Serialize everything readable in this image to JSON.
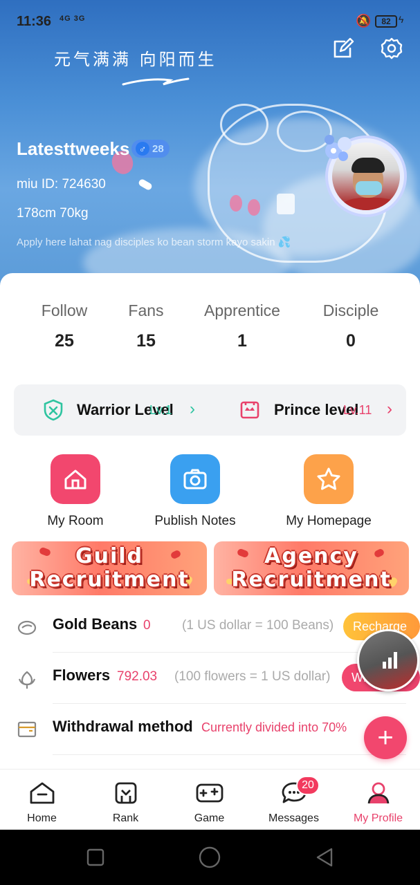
{
  "status_bar": {
    "time": "11:36",
    "network": "4G 3G",
    "battery": "82"
  },
  "header": {
    "slogan": "元气满满  向阳而生",
    "username": "Latesttweeks",
    "gender_symbol": "♂",
    "age": "28",
    "miu_id": "miu ID: 724630",
    "height_weight": "178cm 70kg",
    "bio": "Apply here lahat nag disciples ko bean storm kayo sakin 💦"
  },
  "counts": [
    {
      "label": "Follow",
      "value": "25"
    },
    {
      "label": "Fans",
      "value": "15"
    },
    {
      "label": "Apprentice",
      "value": "1"
    },
    {
      "label": "Disciple",
      "value": "0"
    }
  ],
  "levels": {
    "warrior": {
      "title": "Warrior Level",
      "value": "Lv.1",
      "color": "#2ec4a0"
    },
    "prince": {
      "title": "Prince level",
      "value": "Lv.11",
      "color": "#e8416b"
    }
  },
  "shortcuts": [
    {
      "label": "My Room",
      "color": "#f2476e"
    },
    {
      "label": "Publish Notes",
      "color": "#3aa0f0"
    },
    {
      "label": "My Homepage",
      "color": "#fda24a"
    }
  ],
  "banners": {
    "guild": {
      "line1": "Guild",
      "line2": "Recruitment"
    },
    "agency": {
      "line1": "Agency",
      "line2": "Recruitment"
    }
  },
  "rows": {
    "gold_beans": {
      "title": "Gold Beans",
      "value": "0",
      "note": "(1 US dollar = 100 Beans)",
      "button": "Recharge"
    },
    "flowers": {
      "title": "Flowers",
      "value": "792.03",
      "note": "(100 flowers = 1 US dollar)",
      "button": "Withdraw"
    },
    "withdrawal": {
      "title": "Withdrawal method",
      "value": "Currently divided into 70%"
    }
  },
  "fab": {
    "label": "+"
  },
  "tabs": [
    {
      "label": "Home"
    },
    {
      "label": "Rank"
    },
    {
      "label": "Game"
    },
    {
      "label": "Messages",
      "badge": "20"
    },
    {
      "label": "My Profile"
    }
  ],
  "colors": {
    "accent": "#e8416b",
    "header_blue": "#4a8fd6"
  }
}
